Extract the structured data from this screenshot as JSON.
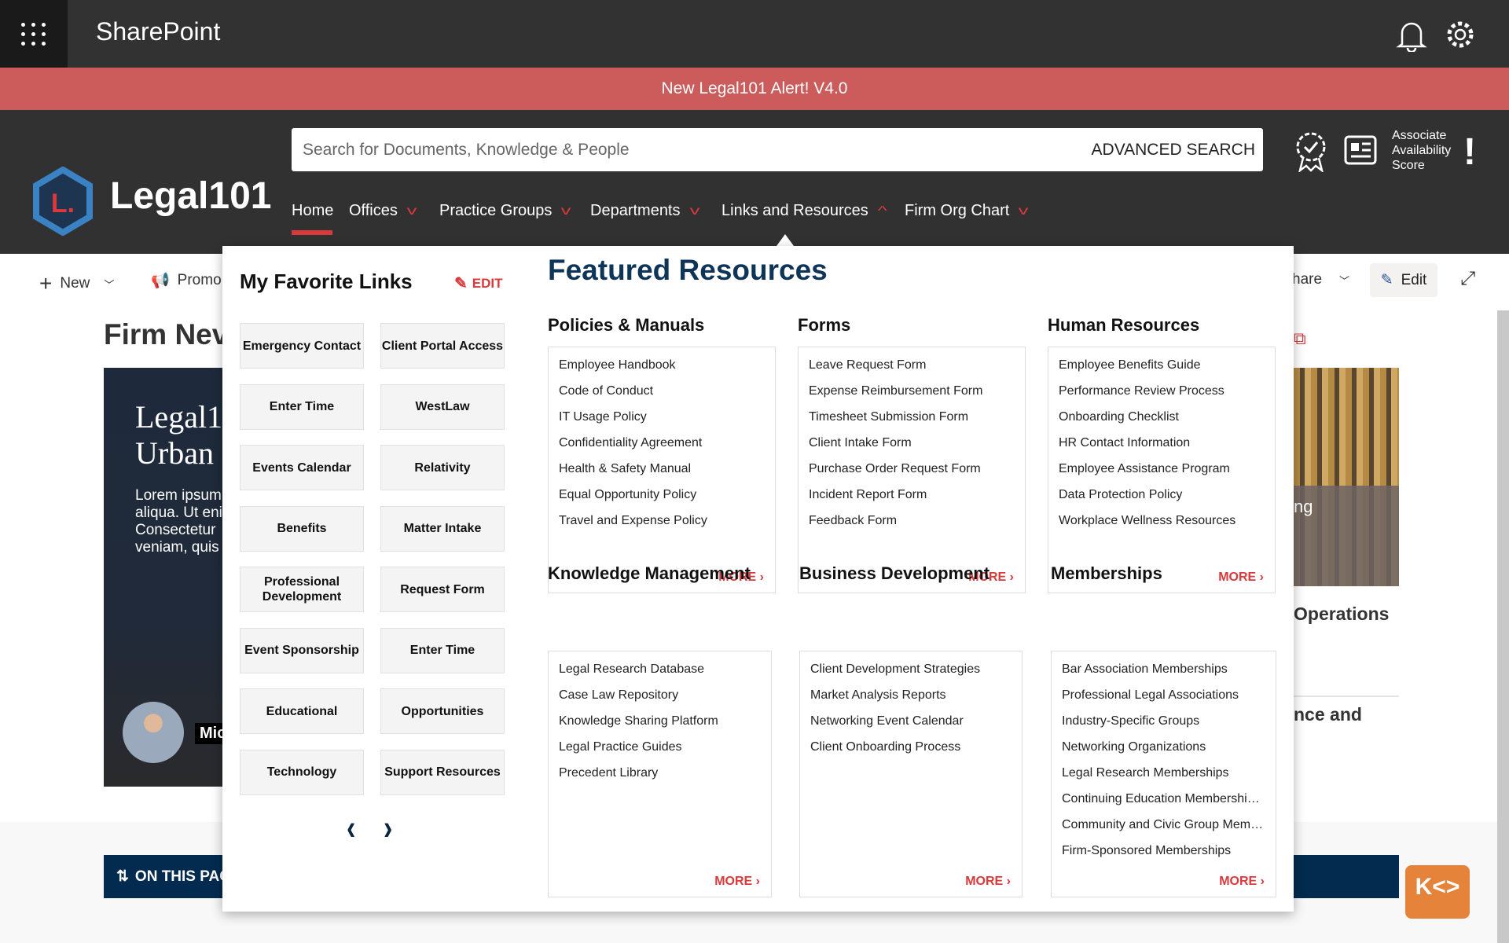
{
  "app": {
    "title": "SharePoint",
    "waffle_icon": "app-launcher-icon",
    "bell_icon": "bell-icon",
    "gear_icon": "gear-icon"
  },
  "alert": {
    "text": "New Legal101 Alert! V4.0",
    "color": "#cc5b5b"
  },
  "brand": {
    "name": "Legal101",
    "logo_letter": "L",
    "logo_color": "#3b82c4"
  },
  "search": {
    "placeholder": "Search for Documents, Knowledge & People",
    "advanced": "ADVANCED SEARCH"
  },
  "header_tools": {
    "score_label": "Associate Availability Score",
    "score_line1": "Associate",
    "score_line2": "Availability",
    "score_line3": "Score",
    "alert_mark": "!"
  },
  "nav": [
    {
      "label": "Home",
      "active": true
    },
    {
      "label": "Offices"
    },
    {
      "label": "Practice Groups"
    },
    {
      "label": "Departments"
    },
    {
      "label": "Links and Resources",
      "open": true
    },
    {
      "label": "Firm Org Chart"
    }
  ],
  "commandbar": {
    "new": "New",
    "promote": "Promo",
    "share": "hare",
    "edit": "Edit"
  },
  "page": {
    "section_title": "Firm Nev",
    "card_title_1": "Legal1(",
    "card_title_2": "Urban",
    "card_body": [
      "Lorem ipsum",
      "aliqua. Ut eni",
      "Consectetur",
      "veniam, quis"
    ],
    "author": "Mic",
    "right_card_overlay": "ng",
    "right_title_1": "Operations",
    "right_title_2": "nce and",
    "on_this_page": "ON THIS PAG"
  },
  "favorites": {
    "title": "My Favorite Links",
    "edit": "EDIT",
    "links": [
      "Emergency Contact",
      "Client Portal Access",
      "Enter Time",
      "WestLaw",
      "Events Calendar",
      "Relativity",
      "Benefits",
      "Matter Intake",
      "Professional Development",
      "Request Form",
      "Event Sponsorship",
      "Enter Time",
      "Educational",
      "Opportunities",
      "Technology",
      "Support Resources"
    ]
  },
  "featured": {
    "title": "Featured Resources",
    "more": "MORE",
    "sections": [
      {
        "title": "Policies & Manuals",
        "items": [
          "Employee Handbook",
          "Code of Conduct",
          "IT Usage Policy",
          "Confidentiality Agreement",
          "Health & Safety Manual",
          "Equal Opportunity Policy",
          "Travel and Expense Policy"
        ]
      },
      {
        "title": "Forms",
        "items": [
          "Leave Request Form",
          "Expense Reimbursement Form",
          "Timesheet Submission Form",
          "Client Intake Form",
          "Purchase Order Request Form",
          "Incident Report Form",
          "Feedback Form"
        ]
      },
      {
        "title": "Human Resources",
        "items": [
          "Employee Benefits Guide",
          "Performance Review Process",
          "Onboarding Checklist",
          "HR Contact Information",
          "Employee Assistance Program",
          "Data Protection Policy",
          "Workplace Wellness Resources"
        ]
      },
      {
        "title": "Knowledge Management",
        "items": [
          "Legal Research Database",
          "Case Law Repository",
          "Knowledge Sharing Platform",
          "Legal Practice Guides",
          "Precedent Library"
        ]
      },
      {
        "title": "Business Development",
        "items": [
          "Client Development Strategies",
          "Market Analysis Reports",
          "Networking Event Calendar",
          "Client Onboarding Process"
        ]
      },
      {
        "title": "Memberships",
        "items": [
          "Bar Association Memberships",
          "Professional Legal Associations",
          "Industry-Specific Groups",
          "Networking Organizations",
          "Legal Research Memberships",
          "Continuing Education Membershi…",
          "Community and Civic Group Mem…",
          "Firm-Sponsored Memberships"
        ]
      }
    ]
  },
  "colors": {
    "accent_red": "#d9393b",
    "navy": "#0e3557",
    "header_dark": "#323131",
    "chat_orange": "#e5833b"
  }
}
